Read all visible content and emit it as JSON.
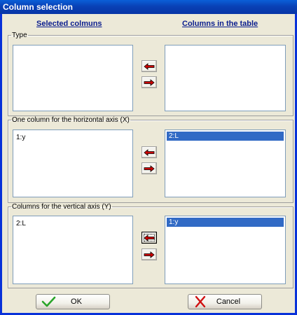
{
  "window": {
    "title": "Column selection"
  },
  "headers": {
    "selected": "Selected colmuns",
    "table": "Columns in the table"
  },
  "groups": {
    "type": {
      "legend": "Type",
      "left_items": [],
      "right_items": []
    },
    "x": {
      "legend": "One column for the horizontal axis (X)",
      "left_items": [
        "1:y"
      ],
      "right_items": [
        "2:L"
      ]
    },
    "y": {
      "legend": "Columns for the vertical axis (Y)",
      "left_items": [
        "2:L"
      ],
      "right_items": [
        "1:y"
      ]
    }
  },
  "buttons": {
    "ok": "OK",
    "cancel": "Cancel"
  },
  "colors": {
    "arrow": "#cc0000",
    "arrow_outline": "#000000",
    "selection": "#316ac5",
    "ok_check": "#2aa52a",
    "cancel_x": "#d01010"
  },
  "icons": {
    "move_left": "left-arrow-icon",
    "move_right": "right-arrow-icon",
    "ok": "check-icon",
    "cancel": "x-icon"
  }
}
